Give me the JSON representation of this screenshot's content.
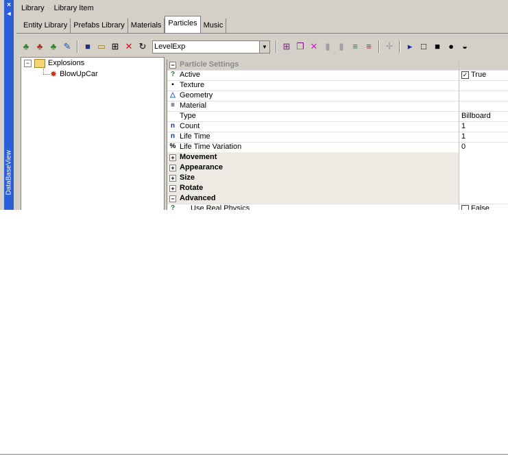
{
  "dock": {
    "label": "DataBaseView",
    "close": "×"
  },
  "menu": [
    "Library",
    "Library Item"
  ],
  "tabs": [
    {
      "label": "Entity Library",
      "active": false
    },
    {
      "label": "Prefabs Library",
      "active": false
    },
    {
      "label": "Materials",
      "active": false
    },
    {
      "label": "Particles",
      "active": true
    },
    {
      "label": "Music",
      "active": false
    }
  ],
  "toolbar": {
    "combo_value": "LevelExp"
  },
  "tree": {
    "group": "Explosions",
    "item": "BlowUpCar"
  },
  "properties": {
    "header": "Particle Settings",
    "rows": [
      {
        "label": "Active",
        "value": "True",
        "icon": "?",
        "checkbox": true
      },
      {
        "label": "Texture",
        "value": "",
        "icon": "▪"
      },
      {
        "label": "Geometry",
        "value": "",
        "icon": "△"
      },
      {
        "label": "Material",
        "value": "",
        "icon": "≡"
      },
      {
        "label": "Type",
        "value": "Billboard",
        "icon": ""
      },
      {
        "label": "Count",
        "value": "1",
        "icon": "n"
      },
      {
        "label": "Life Time",
        "value": "1",
        "icon": "n"
      },
      {
        "label": "Life Time Variation",
        "value": "0",
        "icon": "%"
      }
    ],
    "sections": [
      "Movement",
      "Appearance",
      "Size",
      "Rotate",
      "Advanced"
    ],
    "advanced_row": {
      "label": "Use Real Physics",
      "value": "False"
    }
  },
  "colors": {
    "dock": "#2a5fd6",
    "panel": "#d4d0c8"
  }
}
